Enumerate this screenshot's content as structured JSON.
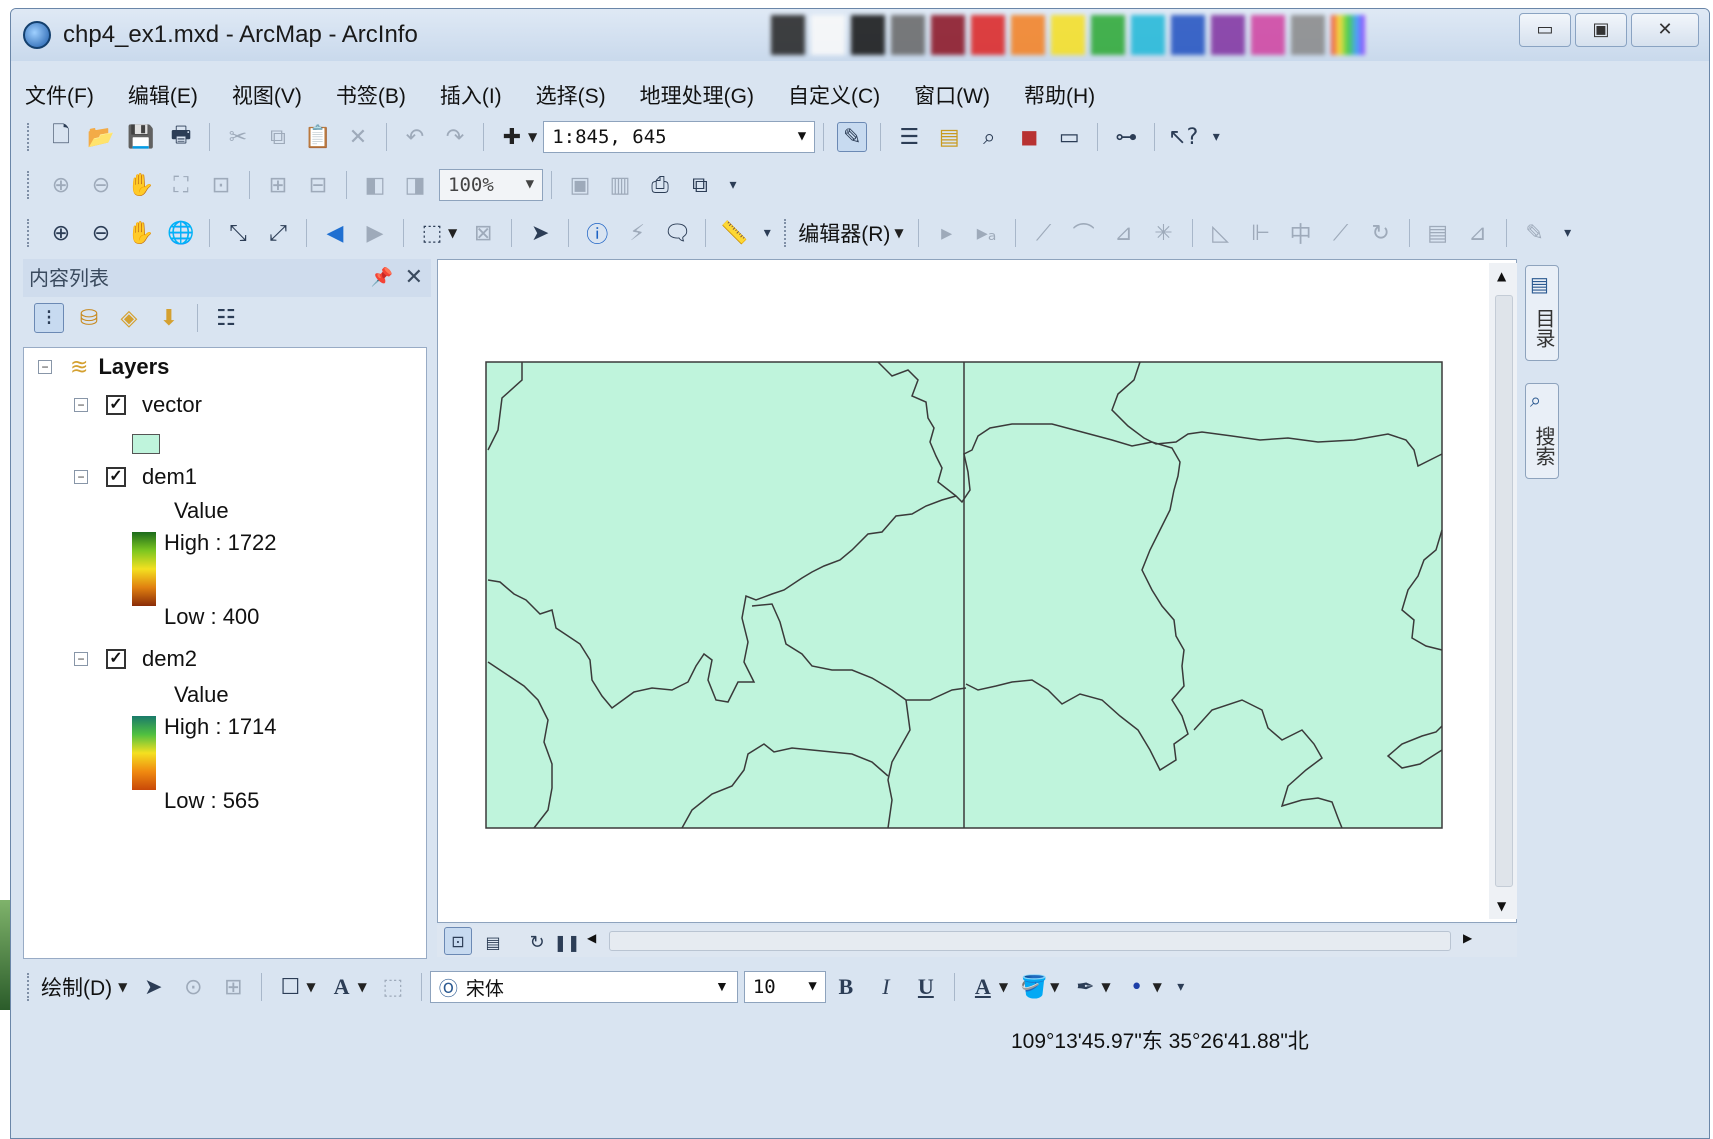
{
  "window": {
    "title": "chp4_ex1.mxd - ArcMap - ArcInfo",
    "buttons": {
      "minimize": "▭",
      "maximize": "▣",
      "close": "✕"
    }
  },
  "menubar": [
    "文件(F)",
    "编辑(E)",
    "视图(V)",
    "书签(B)",
    "插入(I)",
    "选择(S)",
    "地理处理(G)",
    "自定义(C)",
    "窗口(W)",
    "帮助(H)"
  ],
  "toolbar_standard": {
    "scale_value": "1:845, 645"
  },
  "toolbar_layout": {
    "zoom_percent": "100%"
  },
  "toolbar_editor": {
    "editor_label": "编辑器(R)"
  },
  "toc": {
    "title": "内容列表",
    "pin_icon": "pin-icon",
    "close_glyph": "✕",
    "root_label": "Layers",
    "layers": [
      {
        "name": "vector",
        "checked": true,
        "legend": {
          "type": "fill",
          "color": "#bff4dc"
        }
      },
      {
        "name": "dem1",
        "checked": true,
        "legend": {
          "type": "ramp",
          "field": "Value",
          "high": "High : 1722",
          "low": "Low : 400"
        }
      },
      {
        "name": "dem2",
        "checked": true,
        "legend": {
          "type": "ramp",
          "field": "Value",
          "high": "High : 1714",
          "low": "Low : 565"
        }
      }
    ]
  },
  "side_tabs": {
    "catalog": "目录",
    "search": "搜索"
  },
  "map": {
    "fill_color": "#bff4dc",
    "outline_color": "#3a3a3a"
  },
  "drawbar": {
    "draw_label": "绘制(D)",
    "font_name": "宋体",
    "font_size": "10",
    "bold": "B",
    "italic": "I",
    "underline": "U"
  },
  "status": {
    "coordinates": "109°13'45.97\"东  35°26'41.88\"北"
  }
}
